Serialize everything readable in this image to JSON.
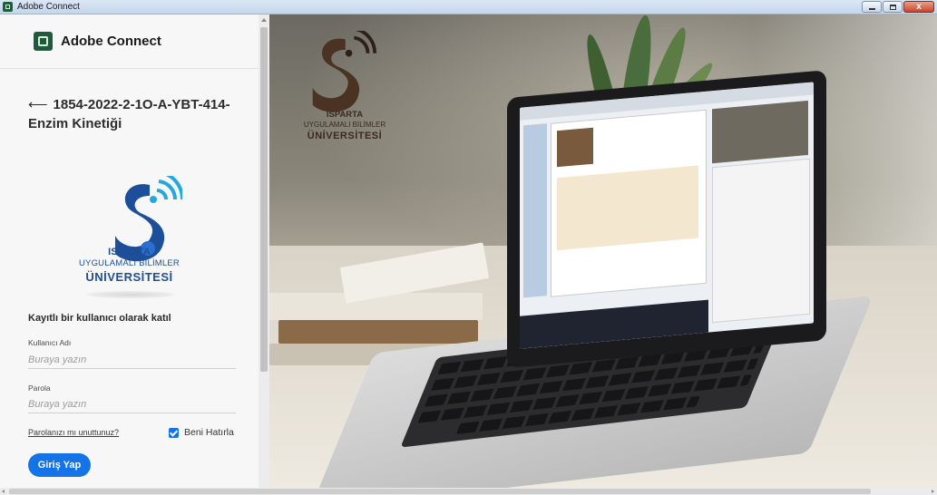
{
  "window": {
    "title": "Adobe Connect",
    "close_glyph": "x"
  },
  "brand": {
    "name": "Adobe Connect"
  },
  "meeting": {
    "back_arrow": "⟵",
    "title": "1854-2022-2-1O-A-YBT-414-Enzim Kinetiği"
  },
  "university": {
    "line1": "ISPARTA",
    "line2": "UYGULAMALI BİLİMLER",
    "line3": "ÜNİVERSİTESİ",
    "badge_year": "2018"
  },
  "login": {
    "heading": "Kayıtlı bir kullanıcı olarak katıl",
    "username_label": "Kullanıcı Adı",
    "username_placeholder": "Buraya yazın",
    "password_label": "Parola",
    "password_placeholder": "Buraya yazın",
    "forgot_link": "Parolanızı mı unuttunuz?",
    "remember_label": "Beni Hatırla",
    "remember_checked": true,
    "submit_label": "Giriş Yap"
  },
  "colors": {
    "accent": "#1473e6",
    "brand": "#1e5b3c",
    "university_blue": "#1d4e99"
  }
}
